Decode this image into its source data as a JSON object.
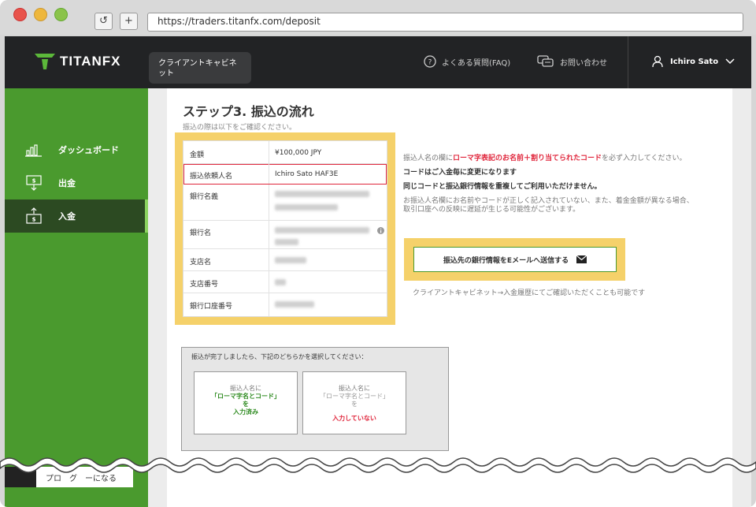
{
  "browser": {
    "url": "https://traders.titanfx.com/deposit",
    "reload_glyph": "↺",
    "newtab_glyph": "+"
  },
  "header": {
    "logo_text": "TITANFX",
    "cabinet_label": "クライアントキャビネット",
    "faq_label": "よくある質問(FAQ)",
    "contact_label": "お問い合わせ",
    "user_name": "Ichiro Sato"
  },
  "sidebar": {
    "items": [
      {
        "label": "ダッシュボード",
        "icon": "bar-chart-icon"
      },
      {
        "label": "出金",
        "icon": "withdraw-icon"
      },
      {
        "label": "入金",
        "icon": "deposit-icon",
        "active": true
      }
    ],
    "bottom_label": "プロ　グ　ーになる"
  },
  "content": {
    "step_title": "ステップ3.  振込の流れ",
    "step_note": "振込の際は以下をご確認ください。",
    "table": [
      {
        "label": "金額",
        "value": "¥100,000 JPY"
      },
      {
        "label": "振込依頼人名",
        "value": "Ichiro Sato HAF3E",
        "highlight": true
      },
      {
        "label": "銀行名義",
        "value": ""
      },
      {
        "label": "銀行名",
        "value": ""
      },
      {
        "label": "支店名",
        "value": ""
      },
      {
        "label": "支店番号",
        "value": ""
      },
      {
        "label": "銀行口座番号",
        "value": ""
      }
    ],
    "info": {
      "line1_pre": "振込人名の欄に",
      "line1_red": "ローマ字表記のお名前＋割り当てられたコード",
      "line1_post": "を必ず入力してください。",
      "line2": "コードはご入金毎に変更になります",
      "line3": "同じコードと振込銀行情報を重複してご利用いただけません。",
      "line4": "お振込人名欄にお名前やコードが正しく記入されていない、また、着金金額が異なる場合、取引口座への反映に遅延が生じる可能性がございます。"
    },
    "email_button": "振込先の銀行情報をEメールへ送信する",
    "cabinet_note": "クライアントキャビネット→入金履歴にてご確認いただくことも可能です",
    "done_prompt": "振込が完了しましたら、下記のどちらかを選択してください：",
    "option_a": {
      "line1": "振込人名に",
      "line2": "「ローマ字名とコード」",
      "line3": "を",
      "line4": "入力済み"
    },
    "option_b": {
      "line1": "振込人名に",
      "line2": "「ローマ字名とコード」",
      "line3": "を",
      "line4": "入力していない"
    }
  },
  "colors": {
    "brand_green": "#4a9a2e",
    "highlight_yellow": "#f5d16a",
    "alert_red": "#e0263c",
    "topbar": "#222325"
  }
}
